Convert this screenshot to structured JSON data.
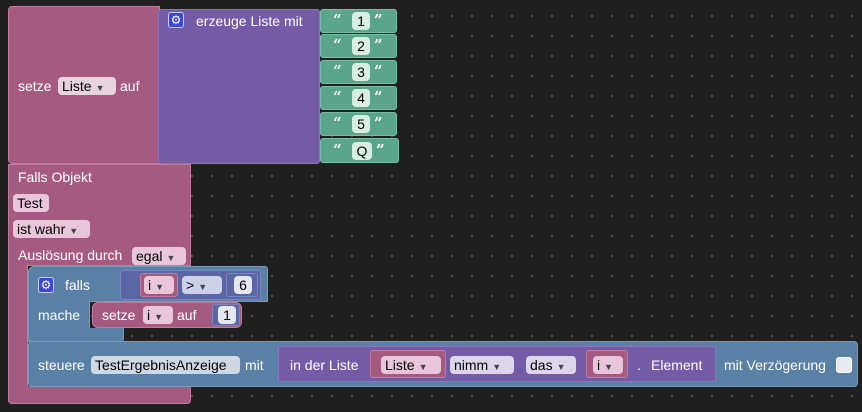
{
  "set_block": {
    "prefix": "setze",
    "variable": "Liste",
    "suffix": "auf"
  },
  "create_list": {
    "label": "erzeuge Liste mit",
    "items": [
      "1",
      "2",
      "3",
      "4",
      "5",
      "Q"
    ]
  },
  "trigger": {
    "title": "Falls Objekt",
    "object": "Test",
    "condition": "ist wahr",
    "trigger_label": "Auslösung durch",
    "trigger_value": "egal"
  },
  "if_block": {
    "if_label": "falls",
    "do_label": "mache",
    "var": "i",
    "operator": ">",
    "value": "6",
    "set_prefix": "setze",
    "set_var": "i",
    "set_suffix": "auf",
    "set_value": "1"
  },
  "control": {
    "prefix": "steuere",
    "target": "TestErgebnisAnzeige",
    "mid": "mit",
    "list_label": "in der Liste",
    "list_var": "Liste",
    "take": "nimm",
    "mode": "das",
    "index_var": "i",
    "dot": ".",
    "element": "Element",
    "delay_label": "mit Verzögerung"
  },
  "colors": {
    "variable_block": "#a55b80",
    "list_block": "#745ba5",
    "text_block": "#5ba58c",
    "logic_block": "#5b80a5",
    "background": "#1f1f1f"
  }
}
